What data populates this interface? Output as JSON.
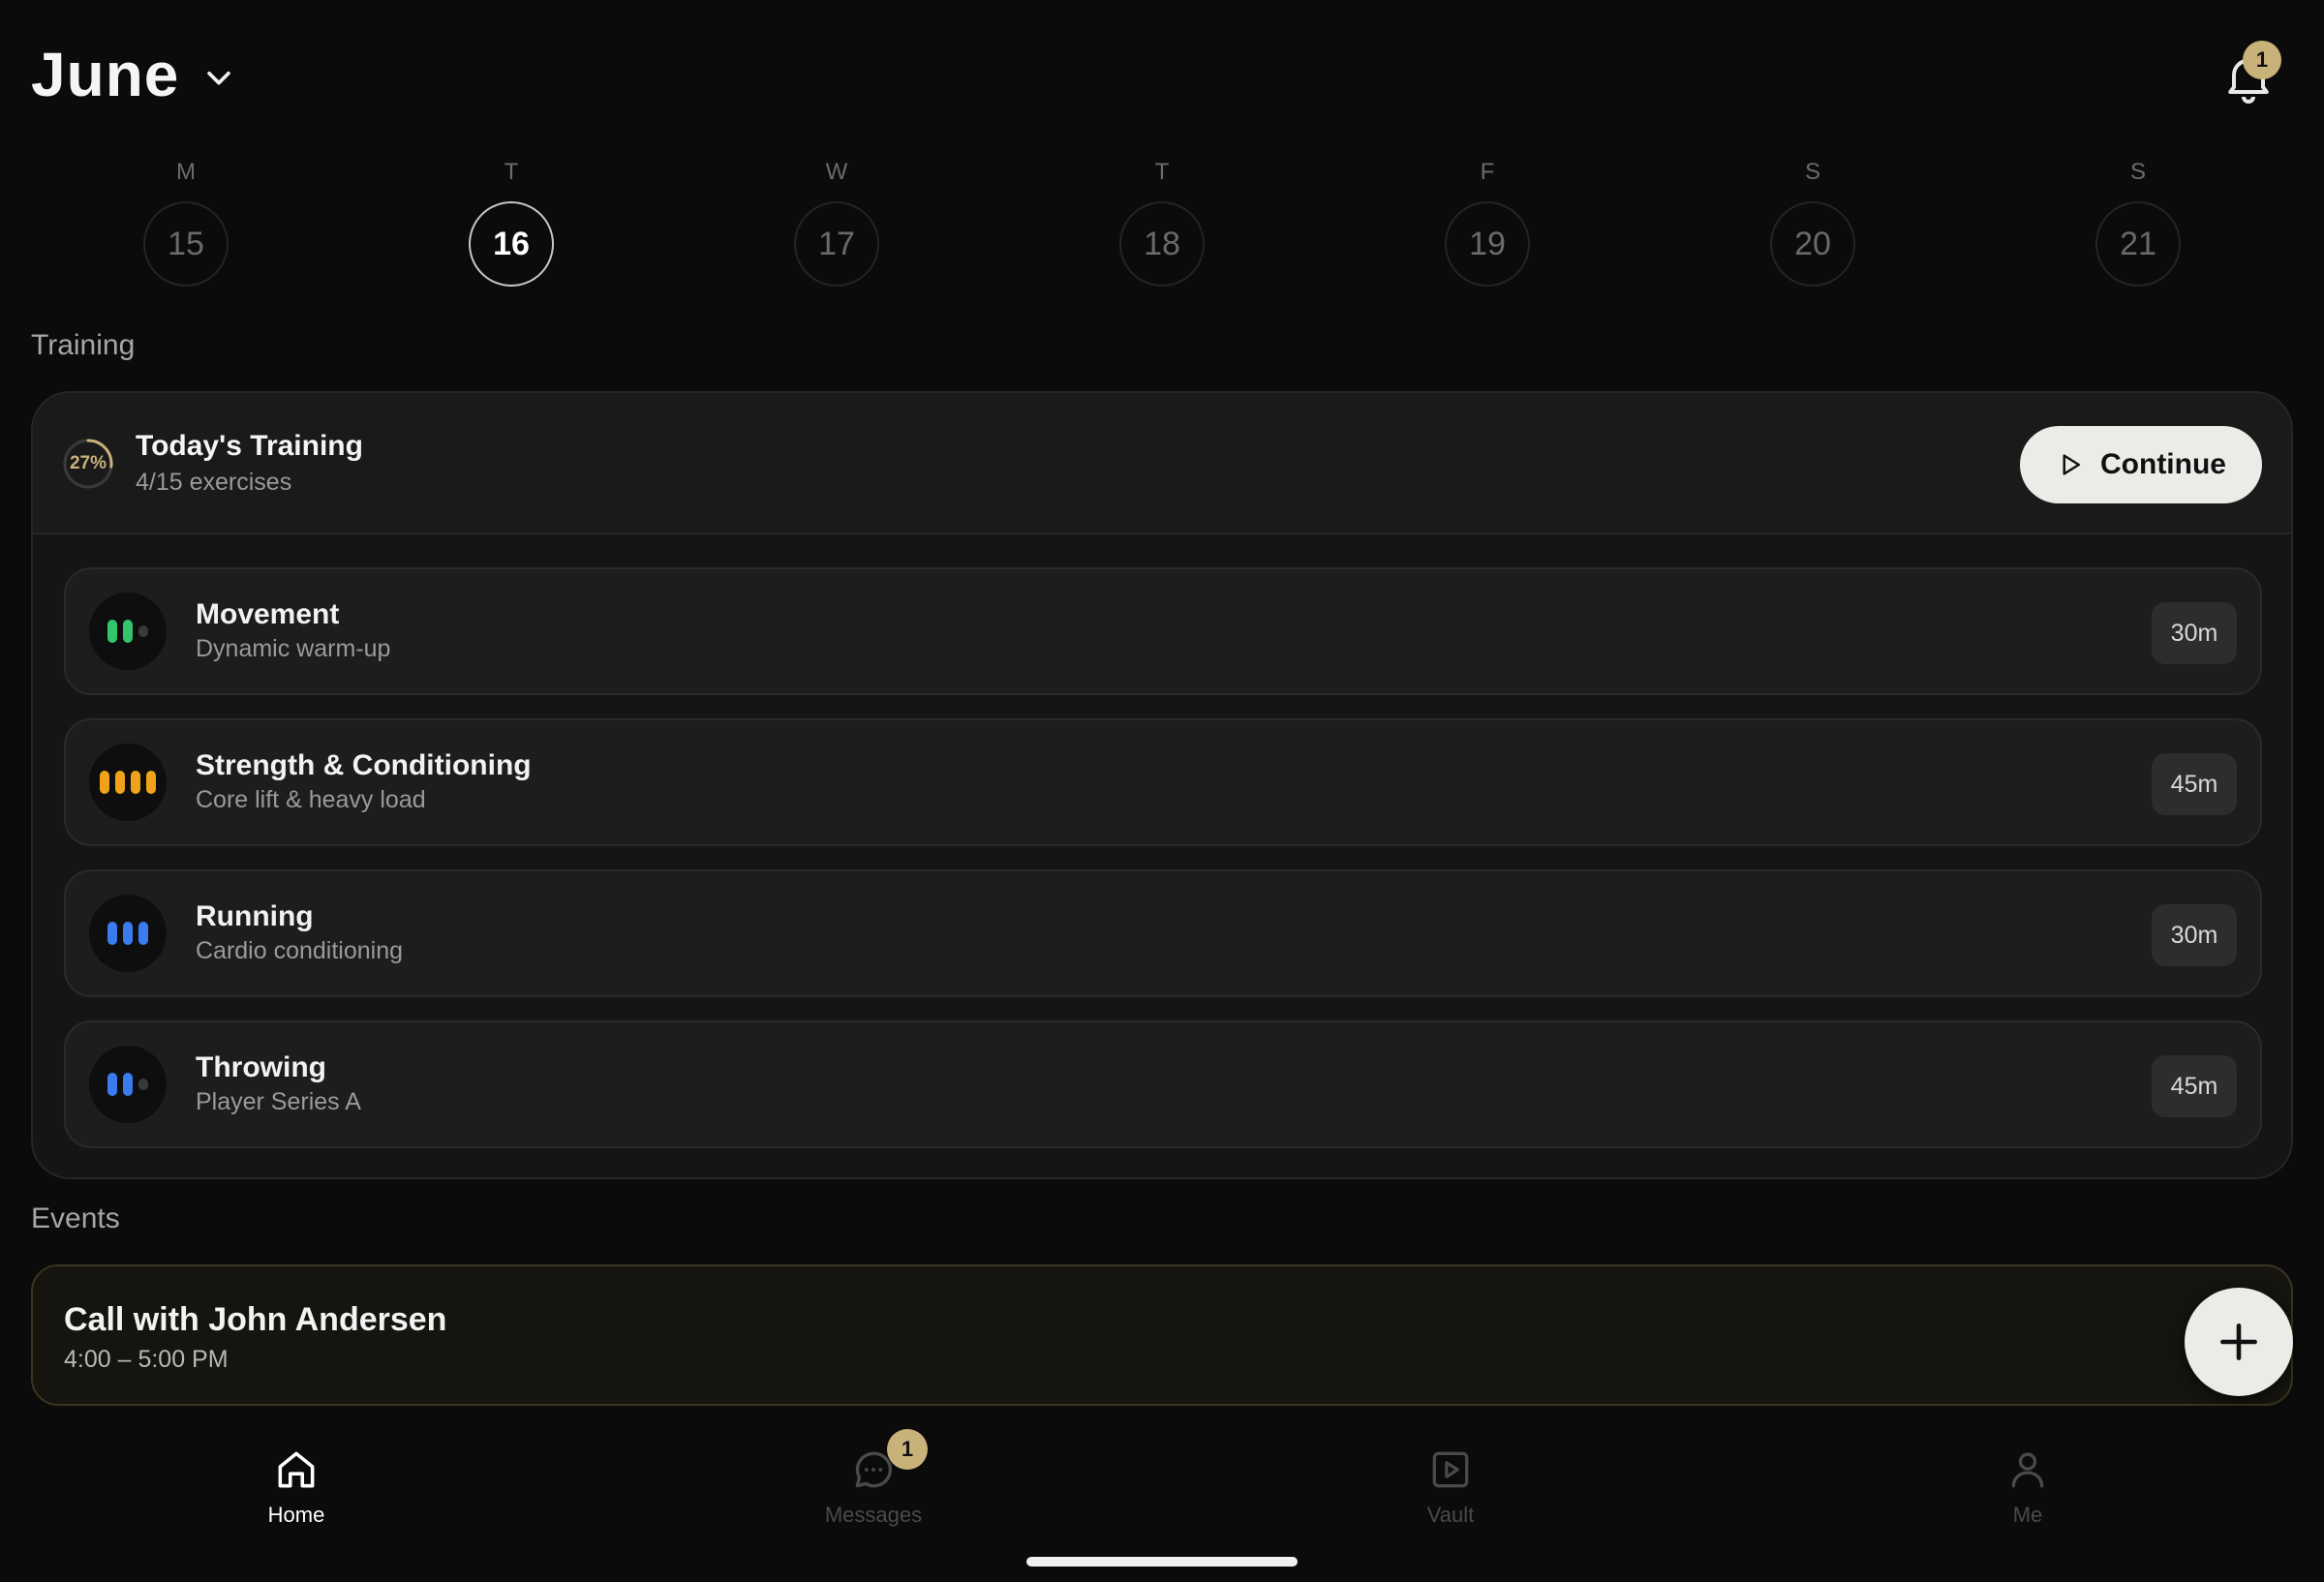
{
  "header": {
    "month": "June",
    "notification_count": "1"
  },
  "week": [
    {
      "dow": "M",
      "date": "15",
      "active": false
    },
    {
      "dow": "T",
      "date": "16",
      "active": true
    },
    {
      "dow": "W",
      "date": "17",
      "active": false
    },
    {
      "dow": "T",
      "date": "18",
      "active": false
    },
    {
      "dow": "F",
      "date": "19",
      "active": false
    },
    {
      "dow": "S",
      "date": "20",
      "active": false
    },
    {
      "dow": "S",
      "date": "21",
      "active": false
    }
  ],
  "training": {
    "section_label": "Training",
    "title": "Today's Training",
    "progress_label": "27%",
    "progress_fraction": 0.27,
    "exercises": "4/15 exercises",
    "continue_label": "Continue",
    "items": [
      {
        "title": "Movement",
        "subtitle": "Dynamic warm-up",
        "duration": "30m",
        "icon": "intensity-bars-icon",
        "color": "#35c46e",
        "bars_filled": 2,
        "bars_total": 3
      },
      {
        "title": "Strength & Conditioning",
        "subtitle": "Core lift & heavy load",
        "duration": "45m",
        "icon": "intensity-bars-icon",
        "color": "#f0a21a",
        "bars_filled": 4,
        "bars_total": 4
      },
      {
        "title": "Running",
        "subtitle": "Cardio conditioning",
        "duration": "30m",
        "icon": "intensity-bars-icon",
        "color": "#3b7bf0",
        "bars_filled": 3,
        "bars_total": 3
      },
      {
        "title": "Throwing",
        "subtitle": "Player Series A",
        "duration": "45m",
        "icon": "intensity-bars-icon",
        "color": "#3b7bf0",
        "bars_filled": 2,
        "bars_total": 3
      }
    ]
  },
  "events": {
    "section_label": "Events",
    "items": [
      {
        "title": "Call with John Andersen",
        "time": "4:00 – 5:00 PM"
      }
    ]
  },
  "tabbar": {
    "items": [
      {
        "label": "Home",
        "icon": "home-icon",
        "active": true
      },
      {
        "label": "Messages",
        "icon": "chat-icon",
        "active": false,
        "badge": "1"
      },
      {
        "label": "Vault",
        "icon": "play-square-icon",
        "active": false
      },
      {
        "label": "Me",
        "icon": "person-icon",
        "active": false
      }
    ]
  },
  "colors": {
    "accent_gold": "#c9b27a",
    "background": "#0b0b0b"
  }
}
